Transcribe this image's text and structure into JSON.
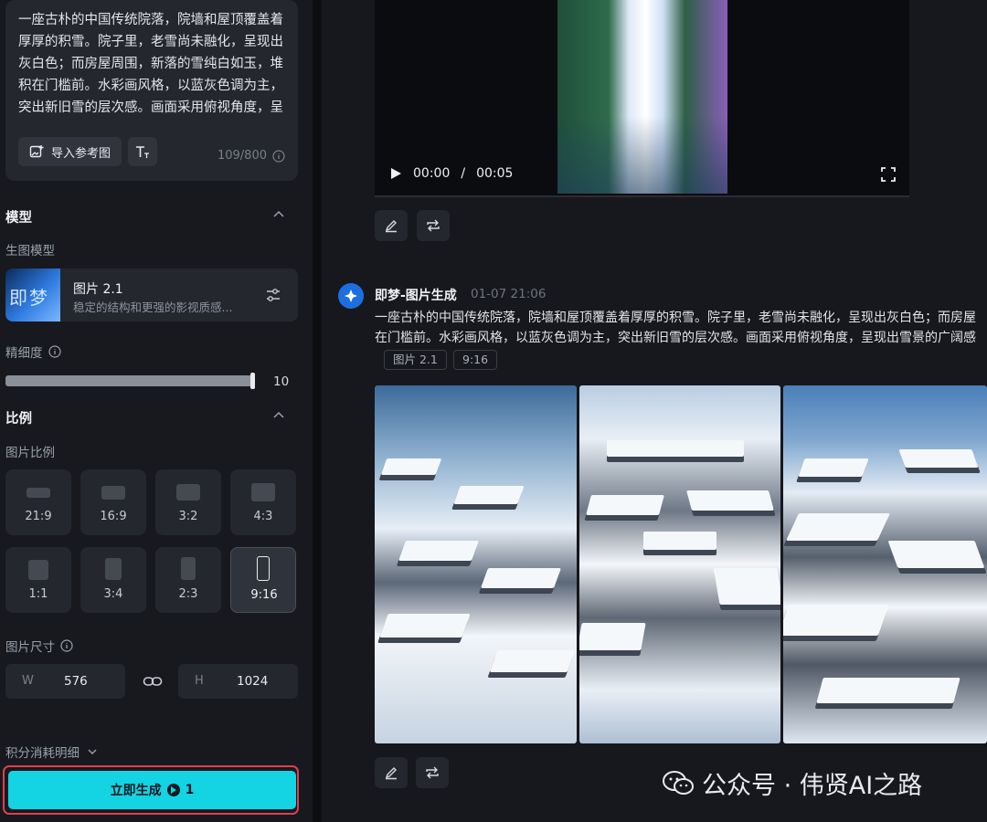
{
  "prompt": {
    "text": "一座古朴的中国传统院落，院墙和屋顶覆盖着厚厚的积雪。院子里，老雪尚未融化，呈现出灰白色；而房屋周围，新落的雪纯白如玉，堆积在门槛前。水彩画风格，以蓝灰色调为主，突出新旧雪的层次感。画面采用俯视角度，呈现出雪景的广阔感。",
    "import_ref_label": "导入参考图",
    "counter": "109/800"
  },
  "model": {
    "section_title": "模型",
    "sub_label": "生图模型",
    "thumb_text": "即梦",
    "name": "图片 2.1",
    "desc": "稳定的结构和更强的影视质感..."
  },
  "precision": {
    "label": "精细度",
    "value": "10",
    "fill": 1.0
  },
  "ratio": {
    "section_title": "比例",
    "sub_label": "图片比例",
    "options": [
      "21:9",
      "16:9",
      "3:2",
      "4:3",
      "1:1",
      "3:4",
      "2:3",
      "9:16"
    ],
    "selected": "9:16"
  },
  "size": {
    "label": "图片尺寸",
    "w_key": "W",
    "w_value": "576",
    "h_key": "H",
    "h_value": "1024"
  },
  "cost_label": "积分消耗明细",
  "generate": {
    "label": "立即生成",
    "cost": "1"
  },
  "video": {
    "current": "00:00",
    "sep": "/",
    "total": "00:05"
  },
  "generation": {
    "title": "即梦-图片生成",
    "time": "01-07  21:06",
    "prompt_line1": "一座古朴的中国传统院落，院墙和屋顶覆盖着厚厚的积雪。院子里，老雪尚未融化，呈现出灰白色；而房屋",
    "prompt_line2": "在门槛前。水彩画风格，以蓝灰色调为主，突出新旧雪的层次感。画面采用俯视角度，呈现出雪景的广阔感",
    "tags": [
      "图片 2.1",
      "9:16"
    ]
  },
  "watermark": "公众号 · 伟贤AI之路",
  "colors": {
    "accent": "#14d3e2",
    "highlight": "#e0404c",
    "panel": "#24272e"
  }
}
